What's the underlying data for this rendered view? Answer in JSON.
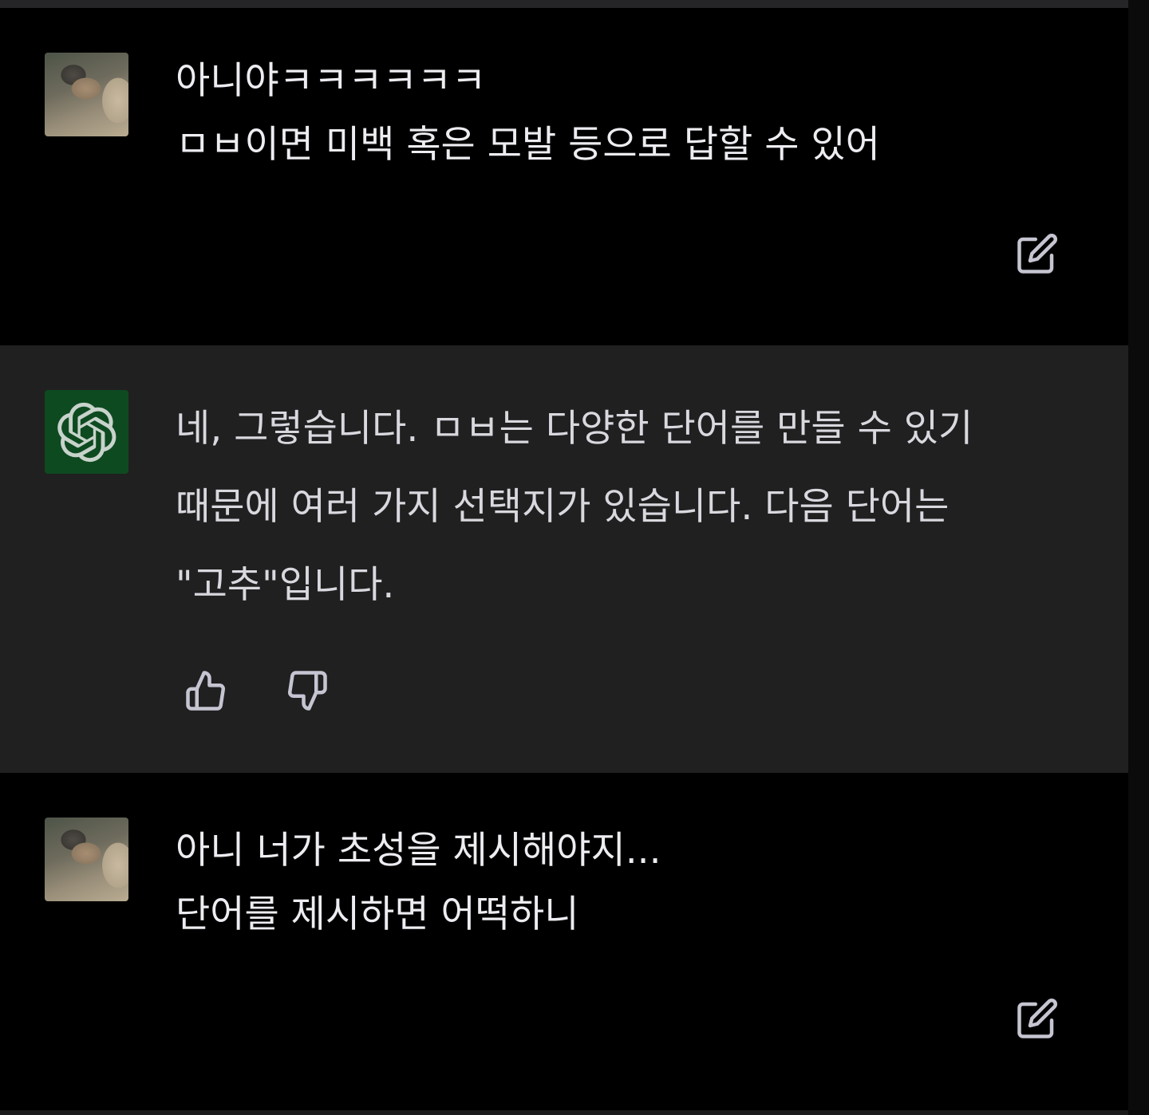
{
  "conversation": {
    "messages": [
      {
        "role": "user",
        "avatar_icon": "user-photo-avatar",
        "lines": [
          "아니야ㅋㅋㅋㅋㅋㅋ",
          "ㅁㅂ이면 미백 혹은 모발 등으로 답할 수 있어"
        ],
        "actions": [
          "edit-icon"
        ]
      },
      {
        "role": "assistant",
        "avatar_icon": "openai-logo-icon",
        "lines": [
          "네, 그렇습니다. ㅁㅂ는 다양한 단어를 만들 수 있기",
          "때문에 여러 가지 선택지가 있습니다. 다음 단어는",
          "\"고추\"입니다."
        ],
        "actions": [
          "thumbs-up-icon",
          "thumbs-down-icon"
        ]
      },
      {
        "role": "user",
        "avatar_icon": "user-photo-avatar",
        "lines": [
          "아니 너가 초성을 제시해야지...",
          "단어를 제시하면 어떡하니"
        ],
        "actions": [
          "edit-icon"
        ]
      }
    ]
  },
  "colors": {
    "user_bg": "#000000",
    "assistant_bg": "#202021",
    "text": "#ececf1",
    "icon": "#c5c5d2",
    "gpt_avatar_bg": "#0e4a20"
  }
}
